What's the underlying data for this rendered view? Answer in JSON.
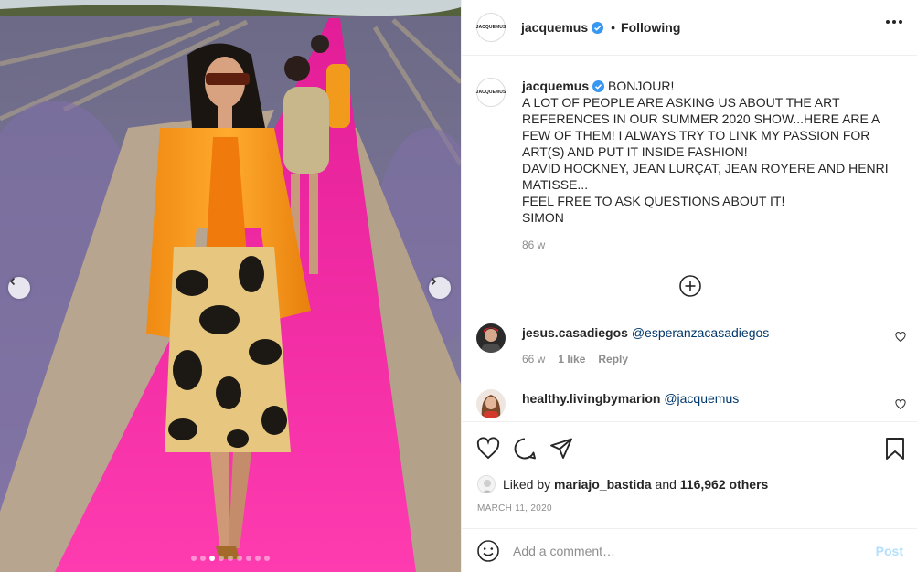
{
  "post": {
    "username": "jacquemus",
    "brand_avatar_text": "JACQUEMUS",
    "follow_separator": "•",
    "follow_status": "Following",
    "caption_lead": "BONJOUR!",
    "caption_body": "A LOT OF PEOPLE ARE ASKING US ABOUT THE ART REFERENCES IN OUR SUMMER 2020 SHOW...HERE ARE A FEW OF THEM! I ALWAYS TRY TO LINK MY PASSION FOR ART(S) AND PUT IT INSIDE FASHION!\nDAVID HOCKNEY, JEAN LURÇAT, JEAN ROYERE AND HENRI MATISSE...\nFEEL FREE TO ASK QUESTIONS ABOUT IT!\nSIMON",
    "caption_age": "86 w",
    "image_icons": {
      "prev": "chevron-left-icon",
      "next": "chevron-right-icon"
    },
    "carousel": {
      "count": 9,
      "active_index": 2
    }
  },
  "comments": [
    {
      "username": "jesus.casadiegos",
      "mention": "@esperanzacasadiegos",
      "age": "66 w",
      "likes": "1 like",
      "reply": "Reply"
    },
    {
      "username": "healthy.livingbymarion",
      "mention": "@jacquemus"
    }
  ],
  "engagement": {
    "liked_prefix": "Liked by",
    "liked_user": "mariajo_bastida",
    "liked_and": "and",
    "others": "116,962 others",
    "date": "MARCH 11, 2020"
  },
  "composer": {
    "placeholder": "Add a comment…",
    "post_label": "Post"
  },
  "colors": {
    "accent_link": "#00376b",
    "verified_blue": "#3897f0",
    "post_disabled": "#b2dffc",
    "runway_pink": "#ff2fa8"
  }
}
